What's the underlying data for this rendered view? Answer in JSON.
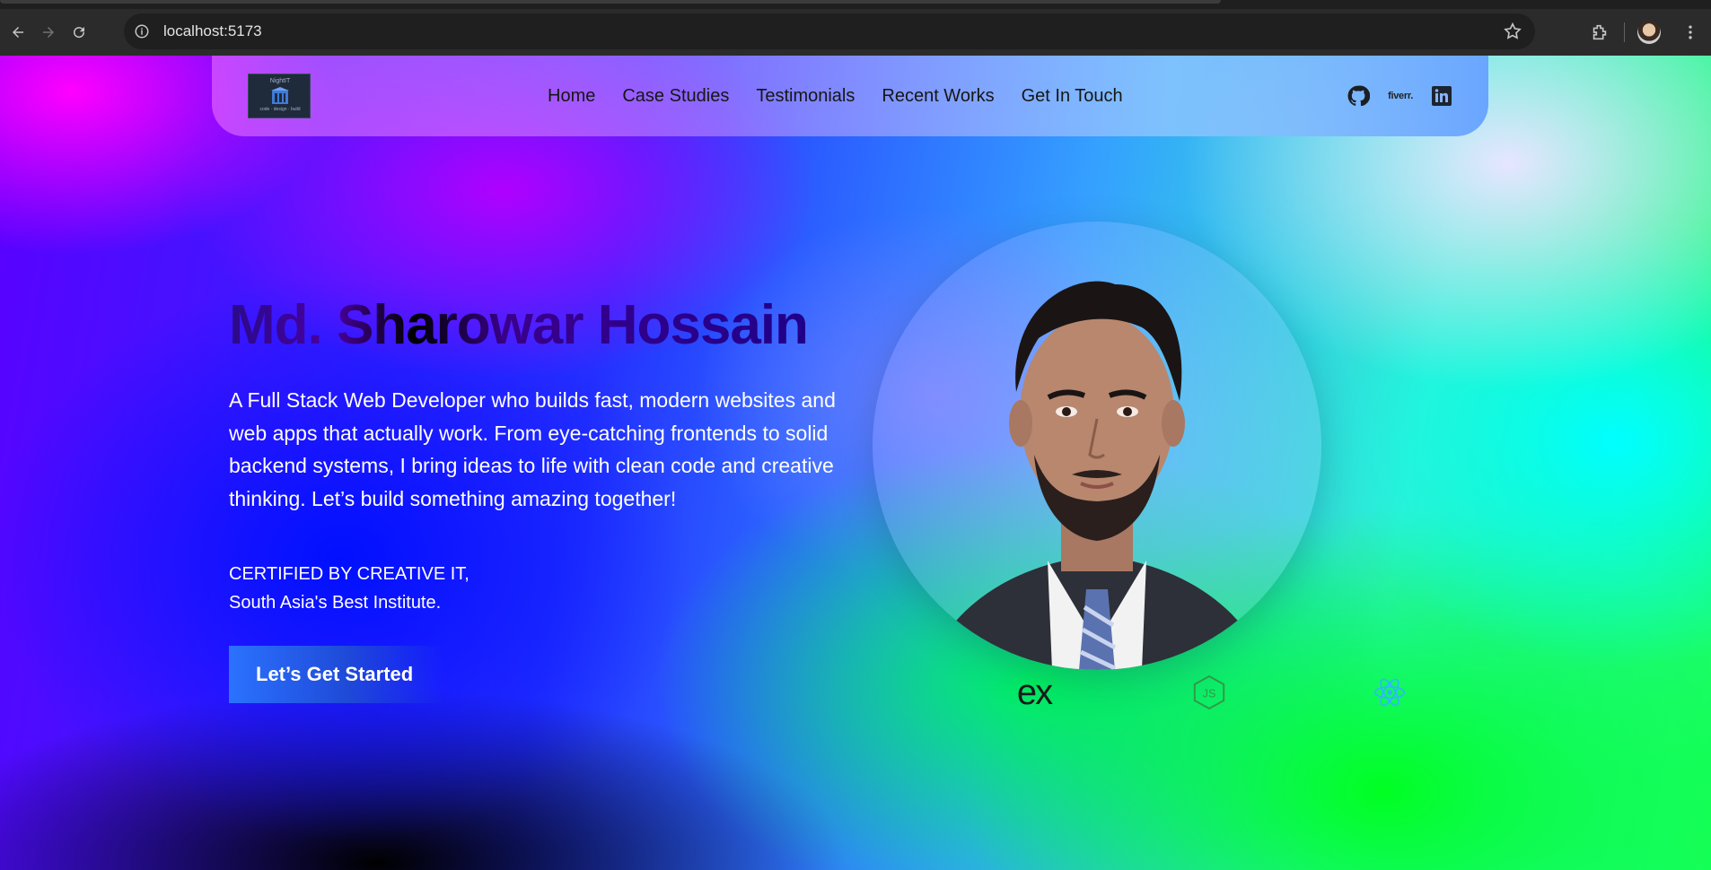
{
  "browser": {
    "url": "localhost:5173"
  },
  "nav": {
    "logo_line1": "NightIT",
    "logo_line2": "code · design · build",
    "menu": [
      {
        "label": "Home"
      },
      {
        "label": "Case Studies"
      },
      {
        "label": "Testimonials"
      },
      {
        "label": "Recent Works"
      },
      {
        "label": "Get In Touch"
      }
    ],
    "socials": {
      "fiverr_label": "fiverr."
    }
  },
  "hero": {
    "title": "Md. Sharowar Hossain",
    "description": "A Full Stack Web Developer who builds fast, modern websites and web apps that actually work. From eye-catching frontends to solid backend systems, I bring ideas to life with clean code and creative thinking. Let’s build something amazing together!",
    "cert_line1": "CERTIFIED BY CREATIVE IT,",
    "cert_line2": "South Asia's Best Institute.",
    "cta_label": "Let’s Get Started"
  },
  "tech": {
    "express_label": "ex"
  },
  "colors": {
    "brand_blue": "#2b72ff",
    "nav_text": "#161616"
  },
  "icons": [
    "back-icon",
    "forward-icon",
    "reload-icon",
    "site-info-icon",
    "bookmark-star-icon",
    "extensions-icon",
    "menu-dots-icon",
    "github-icon",
    "linkedin-icon",
    "nodejs-icon",
    "react-icon"
  ]
}
